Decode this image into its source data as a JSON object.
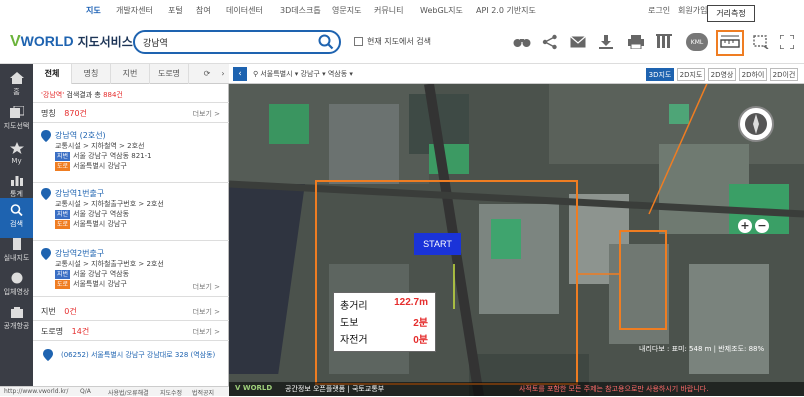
{
  "topnav": {
    "items": [
      "지도",
      "개발자센터",
      "포털",
      "참여",
      "데이터센터",
      "3D데스크톱",
      "영문지도",
      "커뮤니티",
      "WebGL지도",
      "API 2.0 기반지도"
    ],
    "login": "로그인",
    "join": "회원가입"
  },
  "header": {
    "logo_brand": "WORLD",
    "logo_v": "V",
    "logo_service": "지도서비스",
    "search_value": "강남역",
    "checkbox_label": "현재 지도에서 검색",
    "tooltip": "거리측정",
    "kml": "KML"
  },
  "iconbar": {
    "items": [
      "홈",
      "지도선택",
      "My",
      "통계",
      "검색",
      "실내지도",
      "입체영상",
      "공개항공"
    ]
  },
  "panel": {
    "tabs": [
      "전체",
      "명칭",
      "지번",
      "도로명"
    ],
    "summary_keyword": "'강남역'",
    "summary_text": " 검색결과 총 ",
    "summary_count": "884건",
    "section_name_label": "명칭",
    "section_name_count": "870건",
    "more": "더보기 >",
    "results": [
      {
        "title": "강남역 (2호선)",
        "category": "교통시설 > 지하철역 > 2호선",
        "jibun_tag": "지번",
        "jibun": "서울 강남구 역삼동 821-1",
        "doro_tag": "도로",
        "doro": "서울특별시 강남구"
      },
      {
        "title": "강남역1번출구",
        "category": "교통시설 > 지하철출구번호 > 2호선",
        "jibun_tag": "지번",
        "jibun": "서울 강남구 역삼동",
        "doro_tag": "도로",
        "doro": "서울특별시 강남구"
      },
      {
        "title": "강남역2번출구",
        "category": "교통시설 > 지하철출구번호 > 2호선",
        "jibun_tag": "지번",
        "jibun": "서울 강남구 역삼동",
        "doro_tag": "도로",
        "doro": "서울특별시 강남구"
      }
    ],
    "section_jibun_label": "지번",
    "section_jibun_count": "0건",
    "section_doro_label": "도로명",
    "section_doro_count": "14건",
    "doro_result": "(06252) 서울특별시 강남구 강남대로 328 (역삼동)"
  },
  "footer": {
    "url": "http://www.vworld.kr/",
    "links": [
      "Q/A",
      "사용법/오류해결",
      "지도수정",
      "법적공지"
    ]
  },
  "mapbar": {
    "breadcrumb": [
      "서울특별시",
      "강남구",
      "역삼동"
    ],
    "types": [
      "3D지도",
      "2D지도",
      "2D영상",
      "2D하이브",
      "2D이건",
      "2D영상"
    ],
    "active_type": "3D지도"
  },
  "map": {
    "start_label": "START",
    "measure": [
      {
        "label": "총거리",
        "value": "122.7m"
      },
      {
        "label": "도보",
        "value": "2분"
      },
      {
        "label": "자전거",
        "value": "0분"
      }
    ],
    "scale_text": "내리다보 : 표미: 548 m | 반제조도: 88%",
    "legal_brand": "V WORLD",
    "legal_text": "공간정보 오픈플랫폼 | 국토교통부",
    "legal_notice": "사적토를 포함한 모든 주제는 참고용으로만 사용하시기 바랍니다."
  },
  "colors": {
    "accent": "#1e63b0",
    "highlight": "#ef7d22",
    "error": "#e52d2d"
  }
}
